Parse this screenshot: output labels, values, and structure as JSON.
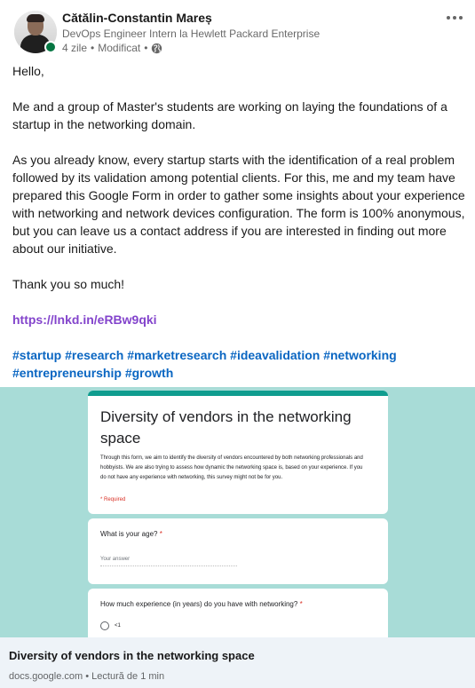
{
  "author": {
    "name": "Cătălin-Constantin Mareș",
    "headline": "DevOps Engineer Intern la Hewlett Packard Enterprise",
    "time": "4 zile",
    "edited": "Modificat",
    "separator": "•",
    "online_color": "#057642"
  },
  "post": {
    "greeting": "Hello,",
    "paragraph1": "Me and a group of Master's students are working on laying the foundations of a startup in the networking domain.",
    "paragraph2": "As you already know, every startup starts with the identification of a real problem followed by its validation among potential clients. For this, me and my team have prepared this Google Form in order to gather some insights about your experience with networking and network devices configuration. The form is 100% anonymous, but you can leave us a contact address if you are interested in finding out more about our initiative.",
    "thanks": "Thank you so much!",
    "link": "https://lnkd.in/eRBw9qki",
    "hashtags": [
      "#startup",
      "#research",
      "#marketresearch",
      "#ideavalidation",
      "#networking",
      "#entrepreneurship",
      "#growth"
    ]
  },
  "preview": {
    "background_color": "#a8dcd7",
    "accent_color": "#0f9d8f",
    "form_title": "Diversity of vendors in the networking space",
    "form_description": "Through this form, we aim to identify the diversity of vendors encountered by both networking professionals and hobbyists. We are also trying to assess how dynamic the networking space is, based on your experience. If you do not have any experience with networking, this survey might not be for you.",
    "required_note": "* Required",
    "q1_label": "What is your age?",
    "q1_required": "*",
    "q1_placeholder": "Your answer",
    "q2_label": "How much experience (in years) do you have with networking?",
    "q2_required": "*",
    "q2_option1": "<1"
  },
  "link_card": {
    "title": "Diversity of vendors in the networking space",
    "domain": "docs.google.com",
    "separator": "•",
    "read_time": "Lectură de 1 min"
  },
  "icons": {
    "more": "more-horizontal-icon",
    "visibility": "globe-icon"
  }
}
